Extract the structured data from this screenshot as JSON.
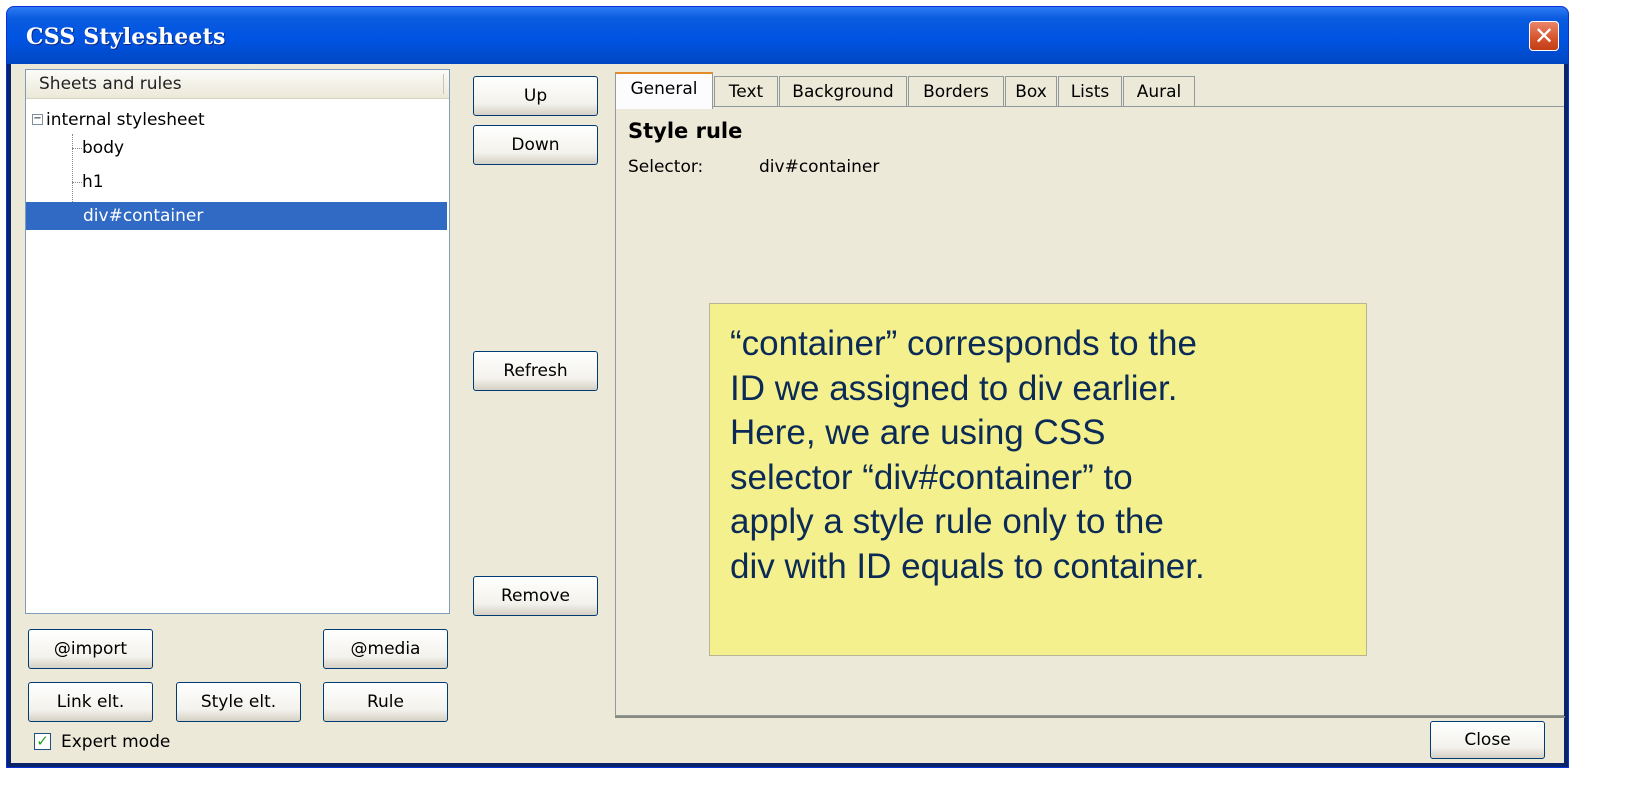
{
  "window": {
    "title": "CSS Stylesheets",
    "close_glyph": "✕"
  },
  "tree": {
    "header": "Sheets and rules",
    "root": {
      "toggle": "−",
      "label": "internal stylesheet"
    },
    "children": [
      "body",
      "h1",
      "div#container"
    ],
    "selected": "div#container"
  },
  "middle_buttons": {
    "up": "Up",
    "down": "Down",
    "refresh": "Refresh",
    "remove": "Remove"
  },
  "bottom_buttons": {
    "import": "@import",
    "media": "@media",
    "link": "Link elt.",
    "style": "Style elt.",
    "rule": "Rule"
  },
  "tabs": [
    {
      "label": "General",
      "active": true
    },
    {
      "label": "Text",
      "active": false
    },
    {
      "label": "Background",
      "active": false
    },
    {
      "label": "Borders",
      "active": false
    },
    {
      "label": "Box",
      "active": false
    },
    {
      "label": "Lists",
      "active": false
    },
    {
      "label": "Aural",
      "active": false
    }
  ],
  "general": {
    "heading": "Style rule",
    "selector_label": "Selector:",
    "selector_value": "div#container"
  },
  "callout": {
    "lines": [
      "“container” corresponds to the",
      "ID we assigned to div earlier.",
      "Here, we are using CSS",
      "selector “div#container” to",
      "apply a style rule only to the",
      "div with ID equals to container."
    ]
  },
  "expert_mode": {
    "label": "Expert mode",
    "checked": true,
    "check_glyph": "✓"
  },
  "close_label": "Close",
  "colors": {
    "title_bar": "#0054e3",
    "selection": "#316ac5",
    "callout_bg": "#f4f08e",
    "callout_text": "#0b2a55",
    "active_tab_accent": "#e68b2c"
  },
  "icons": {
    "close": "close-icon",
    "toggle": "tree-collapse-icon",
    "check": "checkmark-icon"
  }
}
